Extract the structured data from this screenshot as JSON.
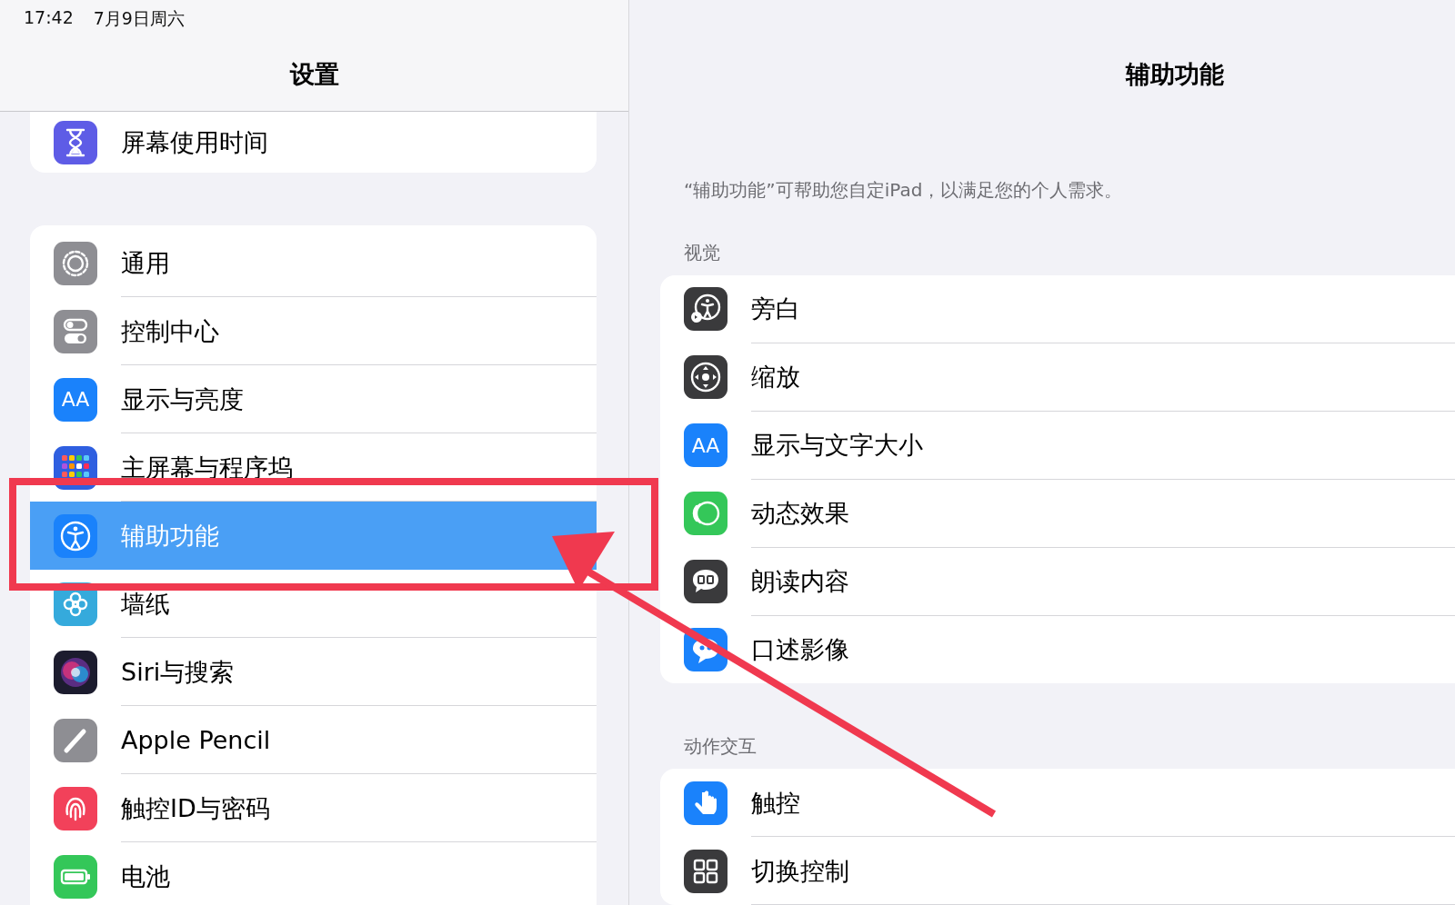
{
  "status_bar": {
    "time": "17:42",
    "date": "7月9日周六"
  },
  "sidebar": {
    "title": "设置",
    "top_items": [
      {
        "label": "屏幕使用时间",
        "kind": "hourglass",
        "color": "#5e5ce6",
        "selected": false
      }
    ],
    "items": [
      {
        "label": "通用",
        "kind": "gear",
        "color": "#8e8e93",
        "selected": false
      },
      {
        "label": "控制中心",
        "kind": "toggles",
        "color": "#8e8e93",
        "selected": false
      },
      {
        "label": "显示与亮度",
        "kind": "letters",
        "icon_text": "AA",
        "color": "#1a82fb",
        "selected": false
      },
      {
        "label": "主屏幕与程序坞",
        "kind": "grid-dots",
        "color": "#2f5fe0",
        "selected": false
      },
      {
        "label": "辅助功能",
        "kind": "person",
        "color": "#1a82fb",
        "selected": true
      },
      {
        "label": "墙纸",
        "kind": "flower",
        "color": "#35aadc",
        "selected": false
      },
      {
        "label": "Siri与搜索",
        "kind": "orb",
        "color": "#1c1c2e",
        "selected": false
      },
      {
        "label": "Apple Pencil",
        "kind": "pencil",
        "color": "#8e8e93",
        "selected": false
      },
      {
        "label": "触控ID与密码",
        "kind": "fingerprint",
        "color": "#f2415a",
        "selected": false
      },
      {
        "label": "电池",
        "kind": "battery",
        "color": "#34c759",
        "selected": false
      }
    ]
  },
  "detail": {
    "title": "辅助功能",
    "description": "“辅助功能”可帮助您自定iPad，以满足您的个人需求。",
    "sections": [
      {
        "header": "视觉",
        "items": [
          {
            "label": "旁白",
            "kind": "person-speaker",
            "color": "#3a3a3c"
          },
          {
            "label": "缩放",
            "kind": "zoom",
            "color": "#3a3a3c"
          },
          {
            "label": "显示与文字大小",
            "kind": "letters",
            "icon_text": "AA",
            "color": "#1a82fb"
          },
          {
            "label": "动态效果",
            "kind": "motion",
            "color": "#34c759"
          },
          {
            "label": "朗读内容",
            "kind": "speech",
            "color": "#3a3a3c"
          },
          {
            "label": "口述影像",
            "kind": "quote-bubble",
            "color": "#1a82fb"
          }
        ]
      },
      {
        "header": "动作交互",
        "items": [
          {
            "label": "触控",
            "kind": "hand",
            "color": "#1a82fb"
          },
          {
            "label": "切换控制",
            "kind": "squares",
            "color": "#3a3a3c"
          }
        ]
      }
    ]
  }
}
